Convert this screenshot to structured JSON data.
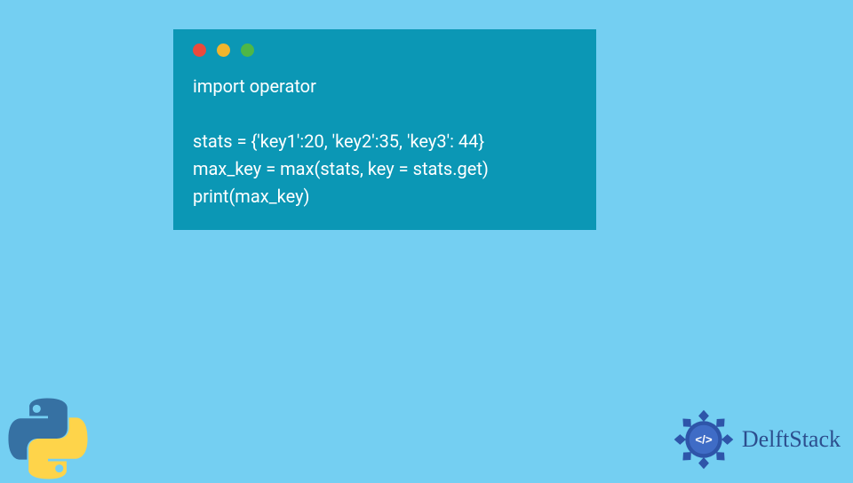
{
  "code": {
    "line1": "import operator",
    "line2": "",
    "line3": "stats = {'key1':20, 'key2':35, 'key3': 44}",
    "line4": "max_key = max(stats, key = stats.get)",
    "line5": "print(max_key)"
  },
  "logos": {
    "delft_text": "DelftStack"
  }
}
